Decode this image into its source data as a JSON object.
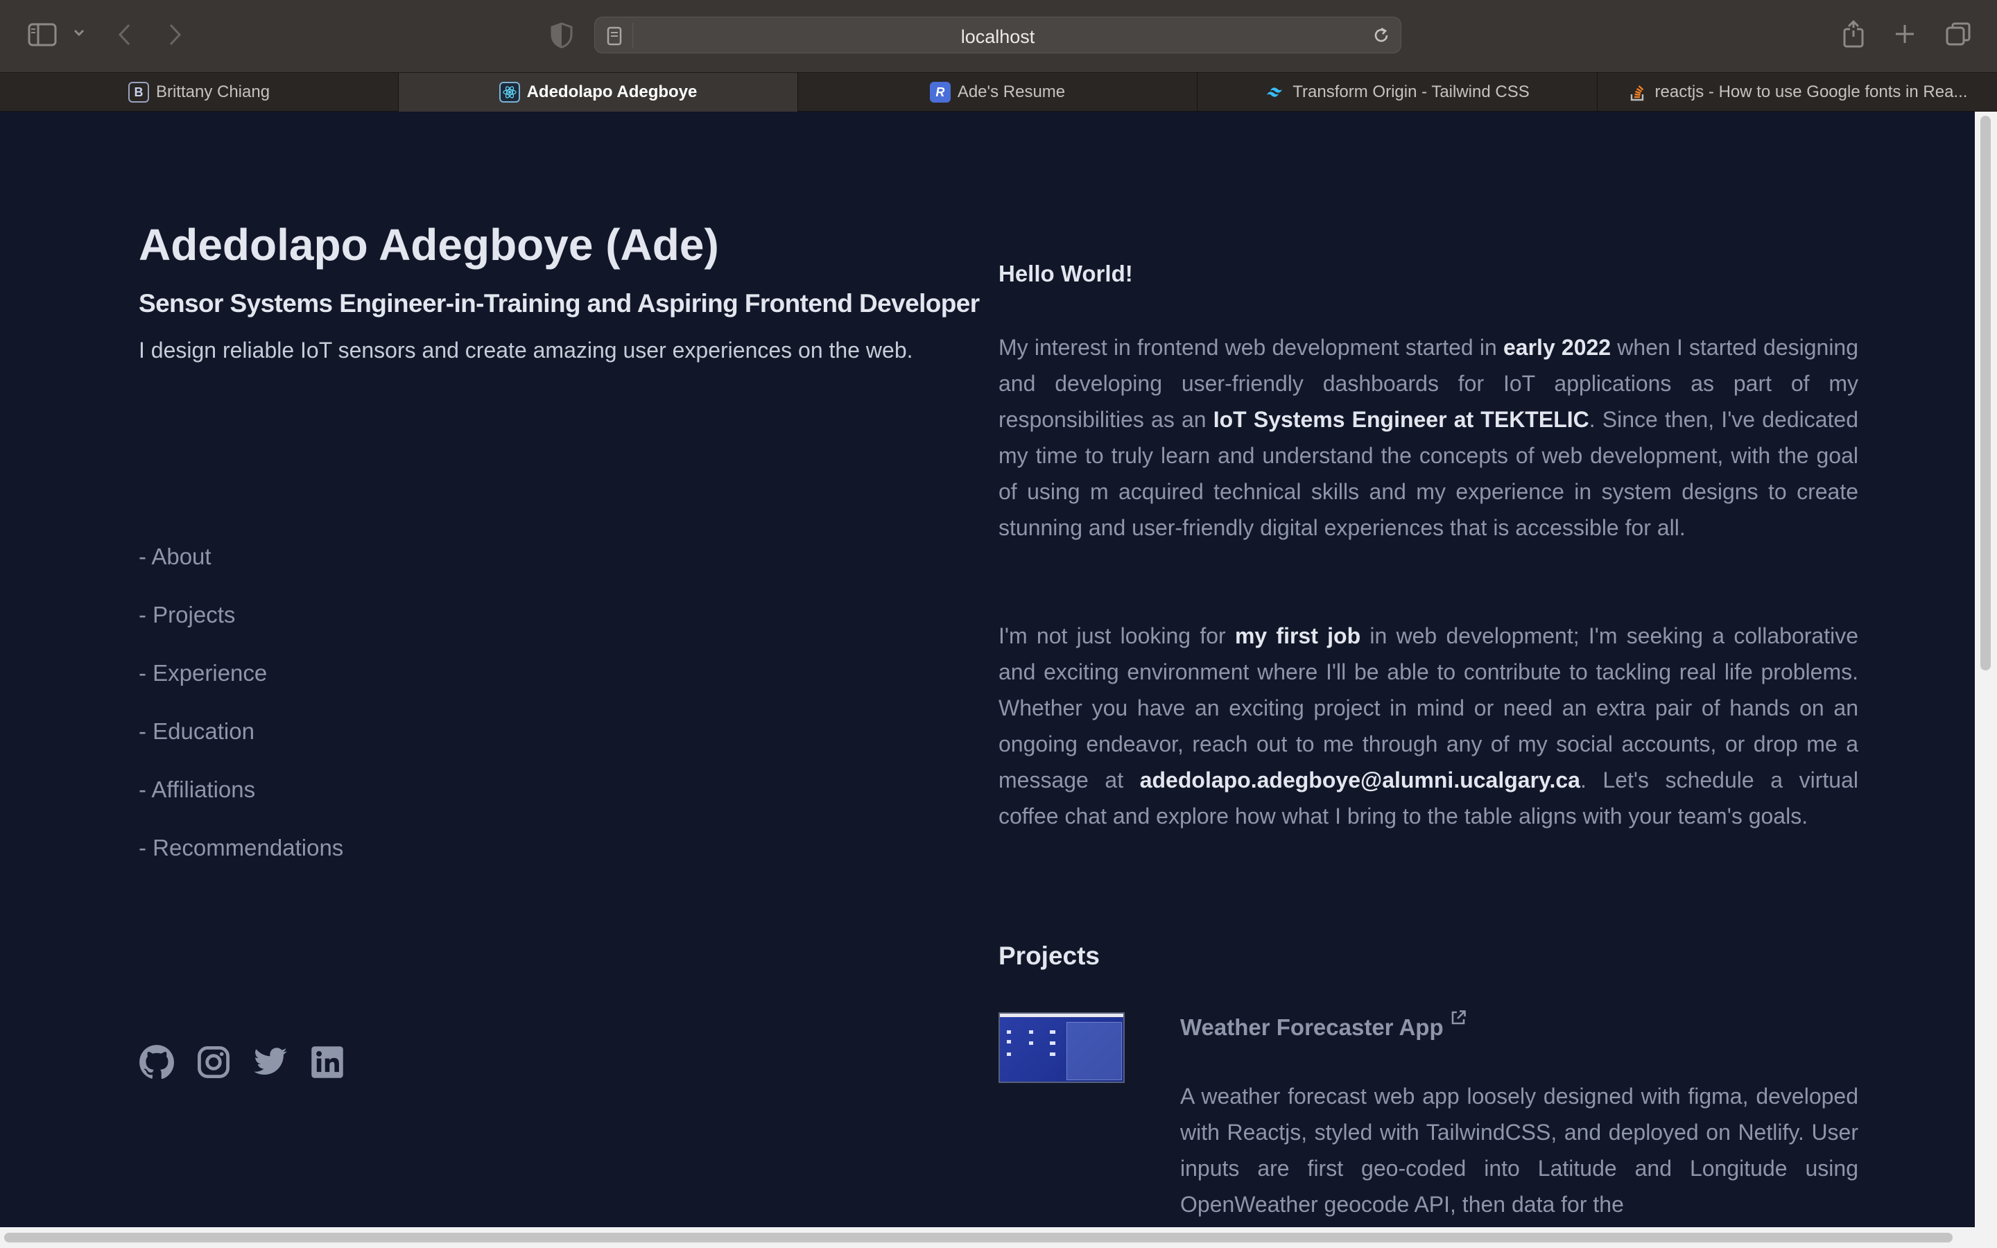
{
  "browser": {
    "url": "localhost",
    "tabs": [
      {
        "label": "Brittany Chiang",
        "favicon": "B",
        "active": false
      },
      {
        "label": "Adedolapo Adegboye",
        "favicon": "react-icon",
        "active": true
      },
      {
        "label": "Ade's Resume",
        "favicon": "R",
        "active": false
      },
      {
        "label": "Transform Origin - Tailwind CSS",
        "favicon": "tailwind-icon",
        "active": false
      },
      {
        "label": "reactjs - How to use Google fonts in Rea...",
        "favicon": "stackoverflow-icon",
        "active": false
      }
    ]
  },
  "hero": {
    "name": "Adedolapo Adegboye (Ade)",
    "role": "Sensor Systems Engineer-in-Training and Aspiring Frontend Developer",
    "tagline": "I design reliable IoT sensors and create amazing user experiences on the web."
  },
  "nav": [
    "- About",
    "- Projects",
    "- Experience",
    "- Education",
    "- Affiliations",
    "- Recommendations"
  ],
  "social": [
    "github-icon",
    "instagram-icon",
    "twitter-icon",
    "linkedin-icon"
  ],
  "about": {
    "greeting": "Hello World!",
    "p1": {
      "t1": "My interest in frontend web development started in ",
      "b1": "early 2022",
      "t2": " when I started designing and developing user-friendly dashboards for IoT applications as part of my responsibilities as an ",
      "b2": "IoT Systems Engineer at TEKTELIC",
      "t3": ". Since then, I've dedicated my time to truly learn and understand the concepts of web development, with the goal of using m acquired technical skills and my experience in system designs to create stunning and user-friendly digital experiences that is accessible for all."
    },
    "p2": {
      "t1": "I'm not just looking for ",
      "b1": "my first job",
      "t2": " in web development; I'm seeking a collaborative and exciting environment where I'll be able to contribute to tackling real life problems. Whether you have an exciting project in mind or need an extra pair of hands on an ongoing endeavor, reach out to me through any of my social accounts, or drop me a message at ",
      "b2": "adedolapo.adegboye@alumni.ucalgary.ca",
      "t3": ". Let's schedule a virtual coffee chat and explore how what I bring to the table aligns with your team's goals."
    }
  },
  "projects": {
    "heading": "Projects",
    "items": [
      {
        "title": "Weather Forecaster App",
        "description": "A weather forecast web app loosely designed with figma, developed with Reactjs, styled with TailwindCSS, and deployed on Netlify. User inputs are first geo-coded into Latitude and Longitude using OpenWeather geocode API, then data for the"
      }
    ]
  }
}
